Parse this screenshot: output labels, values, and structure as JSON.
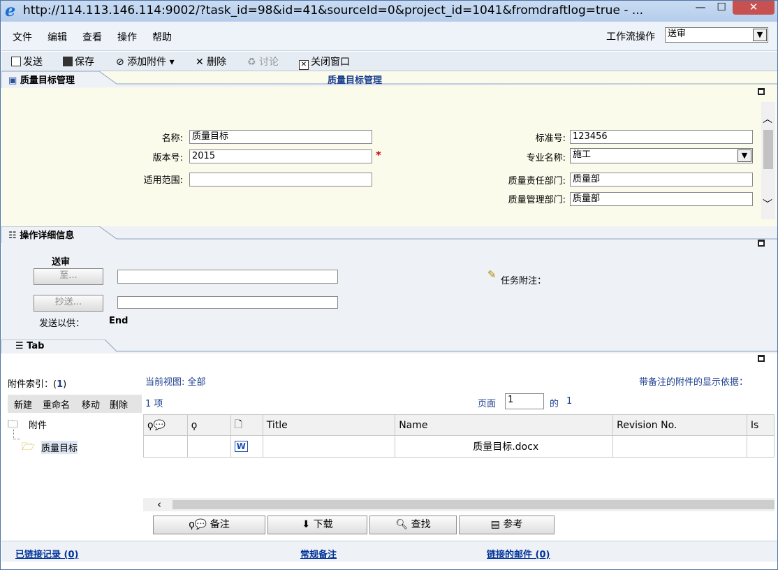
{
  "window": {
    "title": "http://114.113.146.114:9002/?task_id=98&id=41&sourceId=0&project_id=1041&fromdraftlog=true - ...",
    "ie_glyph": "e",
    "min": "—",
    "max": "☐",
    "close": "✕"
  },
  "menu": {
    "items": [
      "文件",
      "编辑",
      "查看",
      "操作",
      "帮助"
    ],
    "workflow_label": "工作流操作",
    "workflow_value": "送审"
  },
  "toolbar": {
    "send": "发送",
    "save": "保存",
    "add_attachment": "添加附件",
    "delete": "删除",
    "discuss": "讨论",
    "close_window": "关闭窗口"
  },
  "quality": {
    "tab_label": "质量目标管理",
    "section_title": "质量目标管理",
    "fields": {
      "name_label": "名称:",
      "name_value": "质量目标",
      "version_label": "版本号:",
      "version_value": "2015",
      "required_mark": "*",
      "scope_label": "适用范围:",
      "scope_value": "",
      "std_label": "标准号:",
      "std_value": "123456",
      "major_label": "专业名称:",
      "major_value": "施工",
      "dept_label": "质量责任部门:",
      "dept_value": "质量部",
      "mgmt_label": "质量管理部门:",
      "mgmt_value": "质量部"
    }
  },
  "ops": {
    "tab_label": "操作详细信息",
    "action_title": "送审",
    "to_button": "至...",
    "cc_button": "抄送...",
    "send_for_label": "发送以供：",
    "send_for_value": "End",
    "task_note_label": "任务附注："
  },
  "tab": {
    "tab_label": "Tab"
  },
  "attachments": {
    "index_label": "附件索引：(",
    "index_count": "1",
    "index_close": ")",
    "actions": [
      "新建",
      "重命名",
      "移动",
      "删除"
    ],
    "tree_root": "附件",
    "tree_child": "质量目标",
    "current_view_label": "当前视图:",
    "current_view_value": "全部",
    "note_basis": "带备注的附件的显示依据：",
    "item_count": "1 项",
    "page_label": "页面",
    "page_value": "1",
    "page_of": "的",
    "page_total": "1",
    "columns": [
      "Title",
      "Name",
      "Revision No.",
      "Is"
    ],
    "rows": [
      {
        "title": "",
        "name": "质量目标.docx",
        "revision": ""
      }
    ],
    "buttons": {
      "note": "备注",
      "download": "下载",
      "find": "查找",
      "reference": "参考"
    }
  },
  "footer": {
    "linked_records": "已链接记录 (0)",
    "regular_notes": "常规备注",
    "linked_mail": "链接的邮件 (0)"
  }
}
